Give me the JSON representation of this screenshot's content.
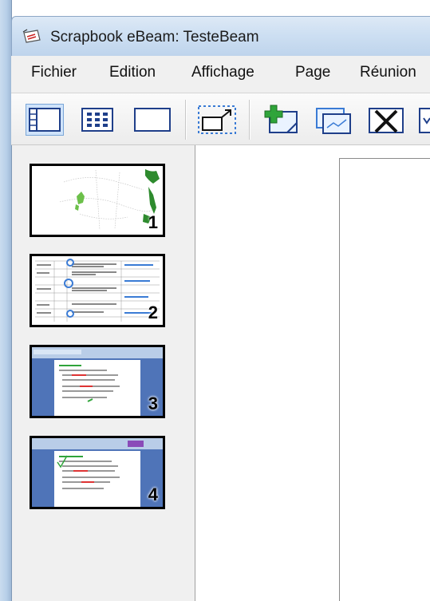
{
  "window": {
    "title": "Scrapbook eBeam: TesteBeam"
  },
  "menu": [
    "Fichier",
    "Edition",
    "Affichage",
    "Page",
    "Réunion"
  ],
  "toolbar": {
    "buttons": [
      "thumbnail-view",
      "grid-view",
      "full-page-view",
      "resize-selection",
      "new-page",
      "duplicate-page",
      "delete-page"
    ]
  },
  "pages": [
    {
      "number": "1"
    },
    {
      "number": "2"
    },
    {
      "number": "3"
    },
    {
      "number": "4"
    }
  ],
  "colors": {
    "titlebar": "#cddff2",
    "selection_blue": "#3a7bd5",
    "green_icon": "#2fa43a"
  }
}
